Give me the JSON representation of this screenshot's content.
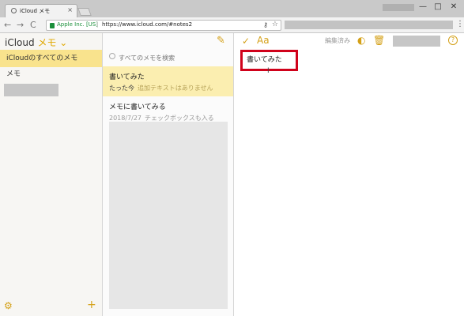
{
  "browser": {
    "tab_title": "iCloud メモ",
    "tab_close": "×",
    "window_controls": {
      "minimize": "—",
      "maximize": "□",
      "close": "✕"
    },
    "nav": {
      "back": "←",
      "forward": "→",
      "reload": "C"
    },
    "address_bar": {
      "secure_label": "Apple Inc. [US]",
      "separator": "|",
      "url": "https://www.icloud.com/#notes2"
    },
    "icons": {
      "key": "⚷",
      "star": "☆",
      "menu": "⋮"
    }
  },
  "sidebar": {
    "app_name": "iCloud",
    "section_name": "メモ",
    "chevron": "⌄",
    "items": [
      {
        "label": "iCloudのすべてのメモ",
        "selected": true
      },
      {
        "label": "メモ",
        "selected": false
      }
    ],
    "settings_icon": "⚙",
    "add_icon": "+"
  },
  "note_list": {
    "compose_icon": "✎",
    "search_placeholder": "すべてのメモを検索",
    "notes": [
      {
        "title": "書いてみた",
        "time": "たった今",
        "preview": "追加テキストはありません",
        "selected": true
      },
      {
        "title": "メモに書いてみる",
        "time": "2018/7/27",
        "preview": "チェックボックスも入る",
        "selected": false
      }
    ]
  },
  "editor": {
    "checklist_icon": "✓",
    "format_label": "Aa",
    "status_label": "編集済み",
    "share_icon": "◐",
    "trash_icon": "🗑",
    "help_label": "?",
    "note_title": "書いてみた",
    "cursor_glyph": "I"
  },
  "colors": {
    "accent": "#d4a017",
    "selection": "#f9e38d",
    "highlight_box": "#d0021b"
  }
}
